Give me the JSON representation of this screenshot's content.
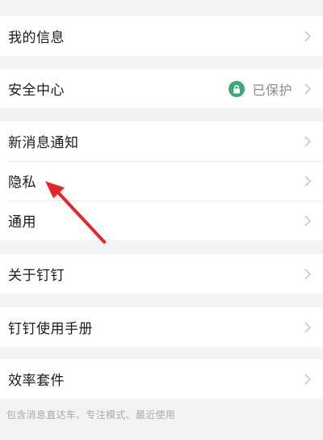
{
  "settings": {
    "my_info": "我的信息",
    "security_center": "安全中心",
    "security_status": "已保护",
    "new_message_notify": "新消息通知",
    "privacy": "隐私",
    "general": "通用",
    "about": "关于钉钉",
    "user_manual": "钉钉使用手册",
    "efficiency_suite": "效率套件",
    "efficiency_suite_desc": "包含消息直达车、专注模式、最近使用"
  },
  "colors": {
    "background": "#f2f3f5",
    "status_green": "#3ba978",
    "annotation_arrow": "#e5252a"
  },
  "icons": {
    "chevron": "chevron-right-icon",
    "lock": "lock-icon",
    "annotation": "red-arrow-annotation"
  }
}
